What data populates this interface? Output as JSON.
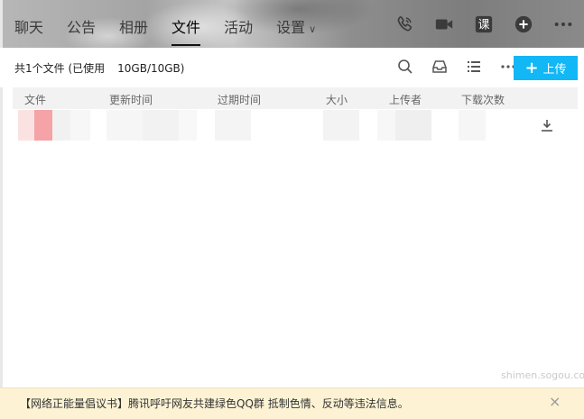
{
  "nav": {
    "items": [
      {
        "label": "聊天",
        "active": false
      },
      {
        "label": "公告",
        "active": false
      },
      {
        "label": "相册",
        "active": false
      },
      {
        "label": "文件",
        "active": true
      },
      {
        "label": "活动",
        "active": false
      },
      {
        "label": "设置",
        "active": false
      }
    ],
    "settings_chevron": "∨"
  },
  "header_icons": [
    "phone-call-icon",
    "video-call-icon",
    "lesson-icon",
    "add-icon",
    "more-icon"
  ],
  "header_lesson_glyph": "课",
  "summary": {
    "left": "共1个文件 (已使用",
    "quota": "10GB/10GB)"
  },
  "toolbar_icons": [
    "search-icon",
    "inbox-icon",
    "list-view-icon",
    "more-icon"
  ],
  "upload_button": {
    "label": "上传",
    "plus": "+"
  },
  "table": {
    "columns": [
      "文件",
      "更新时间",
      "过期时间",
      "大小",
      "上传者",
      "下载次数"
    ]
  },
  "notice": {
    "text": "【网络正能量倡议书】腾讯呼吁网友共建绿色QQ群 抵制色情、反动等违法信息。",
    "close": "×"
  },
  "watermark": "shimen.sogou.com",
  "colors": {
    "accent": "#12b7f5",
    "notice_bg": "#fdf3d4"
  }
}
